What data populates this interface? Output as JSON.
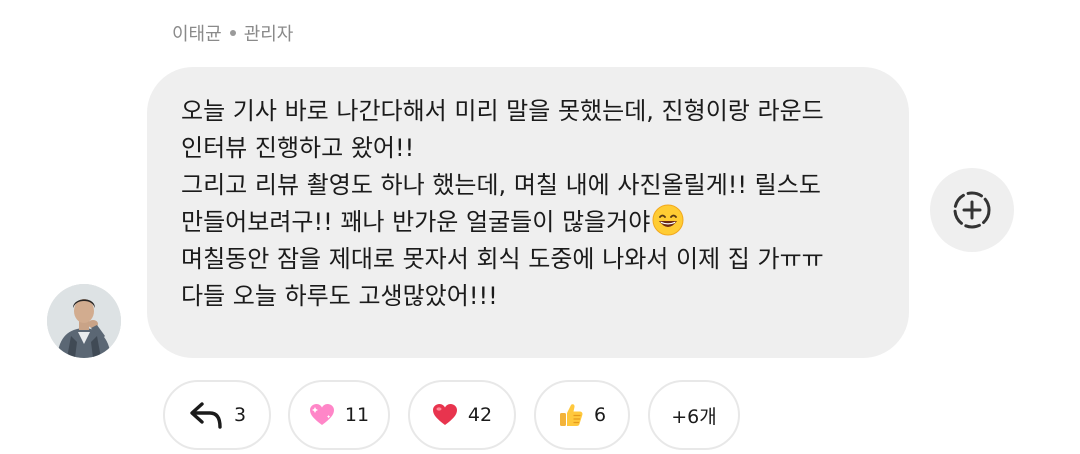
{
  "author": {
    "name": "이태균",
    "role": "관리자"
  },
  "message": {
    "lines": [
      "오늘 기사 바로 나간다해서 미리 말을 못했는데, 진형이랑 라운드",
      "인터뷰 진행하고 왔어!!",
      "그리고 리뷰 촬영도 하나 했는데, 며칠 내에 사진올릴게!! 릴스도",
      "만들어보려구!! 꽤나 반가운 얼굴들이 많을거야",
      "며칠동안 잠을 제대로 못자서 회식 도중에 나와서 이제 집 가ㅠㅠ",
      "다들 오늘 하루도 고생많았어!!!"
    ],
    "inline_emoji": "grinning-smiling-eyes-emoji"
  },
  "reactions": [
    {
      "icon": "reply-arrow-icon",
      "count": "3"
    },
    {
      "icon": "pink-heart-emoji",
      "count": "11"
    },
    {
      "icon": "red-heart-emoji",
      "count": "42"
    },
    {
      "icon": "thumbs-up-emoji",
      "count": "6"
    },
    {
      "icon": "",
      "count": "+6개"
    }
  ],
  "add_reaction_icon": "add-reaction-icon",
  "colors": {
    "bubble": "#efefef",
    "muted_text": "#8a8a8a",
    "pill_border": "#e8e8e8",
    "heart_red": "#e8344e",
    "heart_pink": "#ff86c8"
  }
}
